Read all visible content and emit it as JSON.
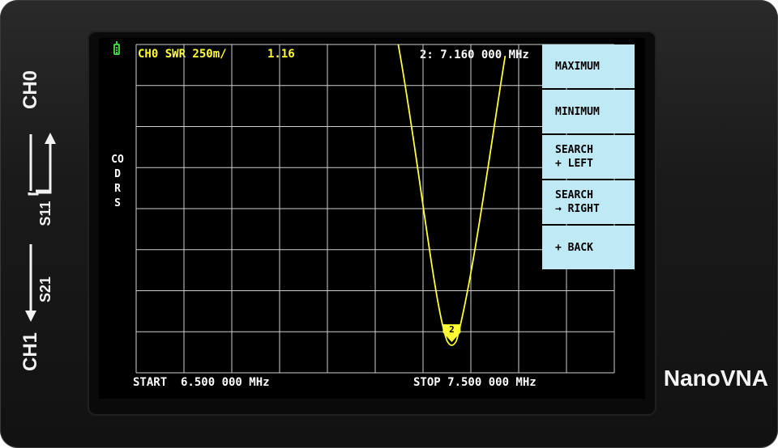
{
  "device": {
    "brand": "NanoVNA",
    "ports": {
      "ch0": "CH0",
      "ch1": "CH1",
      "s11": "S11",
      "s21": "S21"
    }
  },
  "header": {
    "trace": "CH0 SWR 250m/",
    "value": "1.16",
    "marker_readout": "2: 7.160 000 MHz"
  },
  "side_labels": [
    "CO",
    "D",
    "R",
    "S"
  ],
  "menu": {
    "items": [
      {
        "lines": [
          "MAXIMUM"
        ]
      },
      {
        "lines": [
          "MINIMUM"
        ]
      },
      {
        "lines": [
          "SEARCH",
          "+ LEFT"
        ]
      },
      {
        "lines": [
          "SEARCH",
          "→ RIGHT"
        ]
      },
      {
        "lines": [
          "+ BACK"
        ]
      }
    ]
  },
  "footer": {
    "start": "START  6.500 000 MHz",
    "stop": "STOP 7.500 000 MHz"
  },
  "marker": {
    "id": "2",
    "frequency_mhz": 7.16
  },
  "colors": {
    "trace": "#ffff33",
    "grid": "#cfcfcf",
    "menu_bg": "#bfe9f5",
    "battery": "#3cd23c",
    "screen_bg": "#000000"
  }
}
